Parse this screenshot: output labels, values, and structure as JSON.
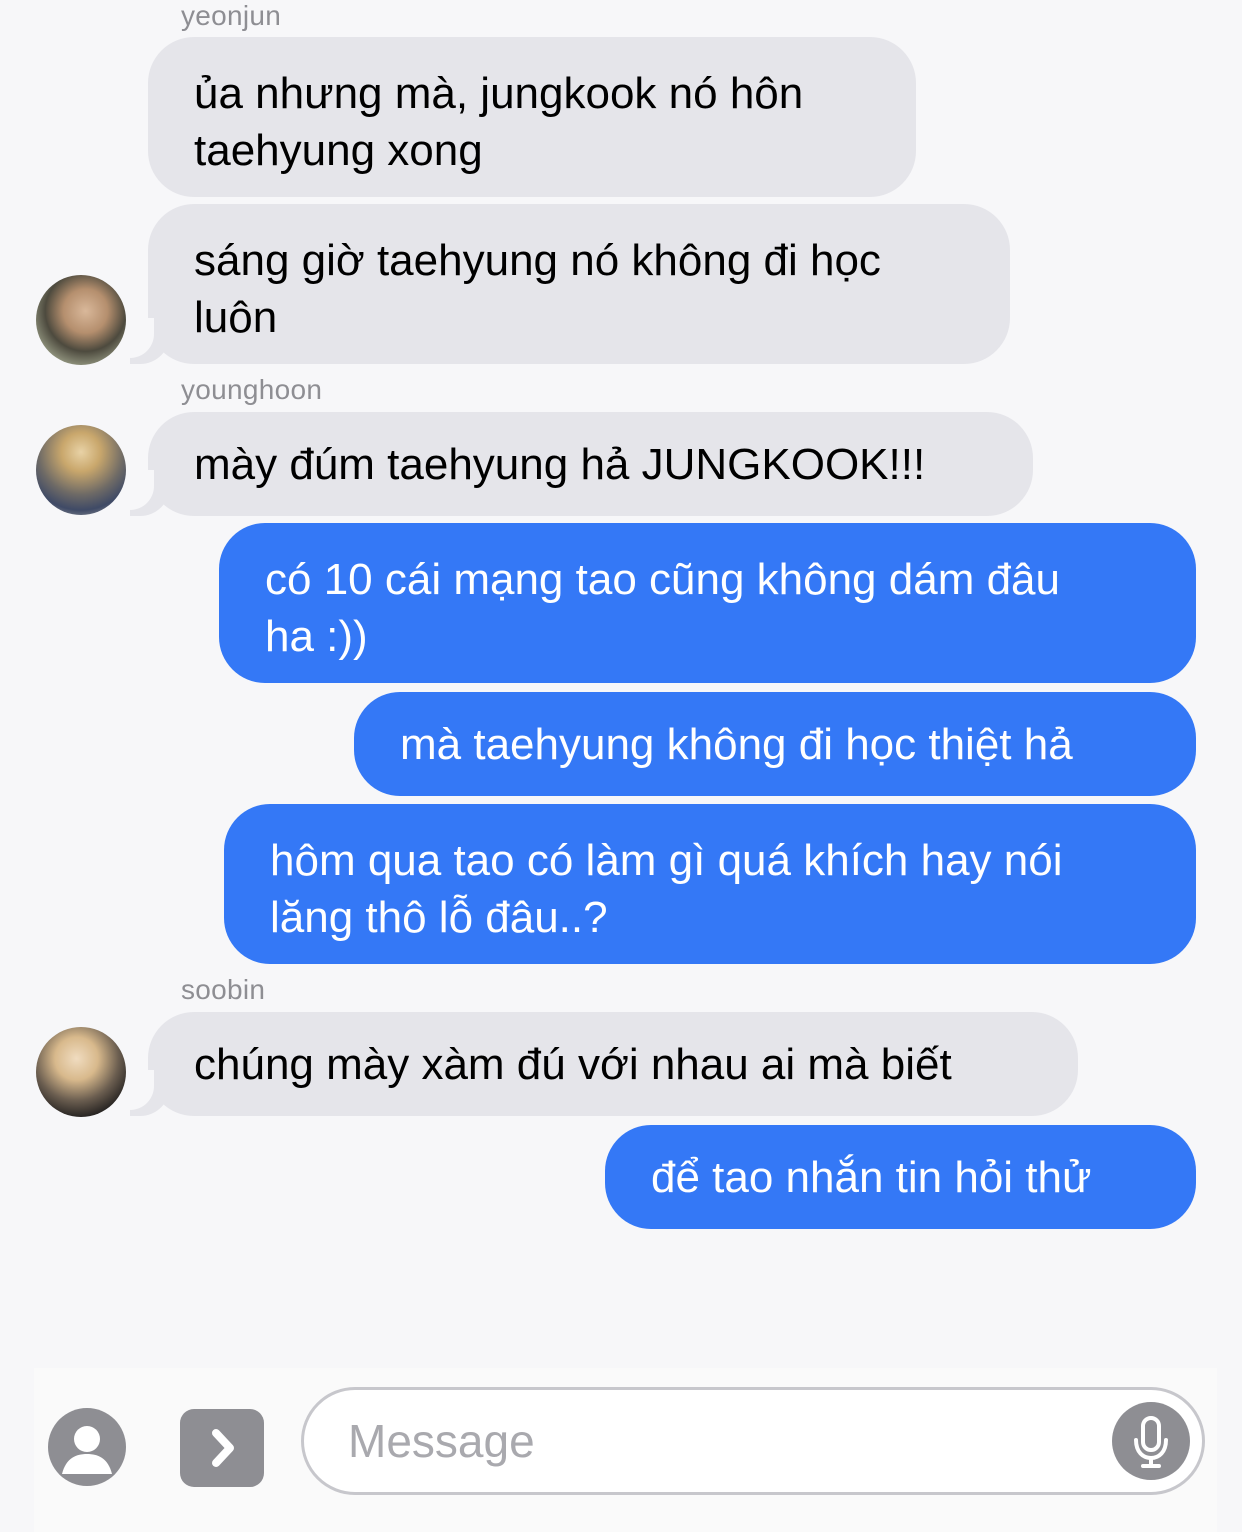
{
  "messages": [
    {
      "sender": "yeonjun",
      "direction": "incoming",
      "lines": [
        "ủa nhưng mà, jungkook nó hôn",
        "taehyung xong"
      ]
    },
    {
      "direction": "incoming",
      "lines": [
        "sáng giờ taehyung nó không đi học",
        "luôn"
      ]
    },
    {
      "sender": "younghoon",
      "direction": "incoming",
      "lines": [
        "mày đúm taehyung hả JUNGKOOK!!!"
      ]
    },
    {
      "direction": "outgoing",
      "lines": [
        "có 10 cái mạng tao cũng không dám đâu",
        "ha :))"
      ]
    },
    {
      "direction": "outgoing",
      "lines": [
        "mà taehyung không đi học thiệt hả"
      ]
    },
    {
      "direction": "outgoing",
      "lines": [
        "hôm qua tao có làm gì quá khích hay nói",
        "lăng thô lỗ đâu..?"
      ]
    },
    {
      "sender": "soobin",
      "direction": "incoming",
      "lines": [
        "chúng mày xàm đú với nhau ai mà biết"
      ]
    },
    {
      "direction": "outgoing",
      "lines": [
        "để tao nhắn tin hỏi thử"
      ]
    }
  ],
  "input": {
    "placeholder": "Message"
  },
  "icons": {
    "camera": "person-silhouette-icon",
    "apps": "chevron-right-icon",
    "mic": "microphone-icon"
  },
  "colors": {
    "outgoing_bubble": "#3478f6",
    "incoming_bubble": "#e5e5ea",
    "background": "#f7f7f9"
  }
}
